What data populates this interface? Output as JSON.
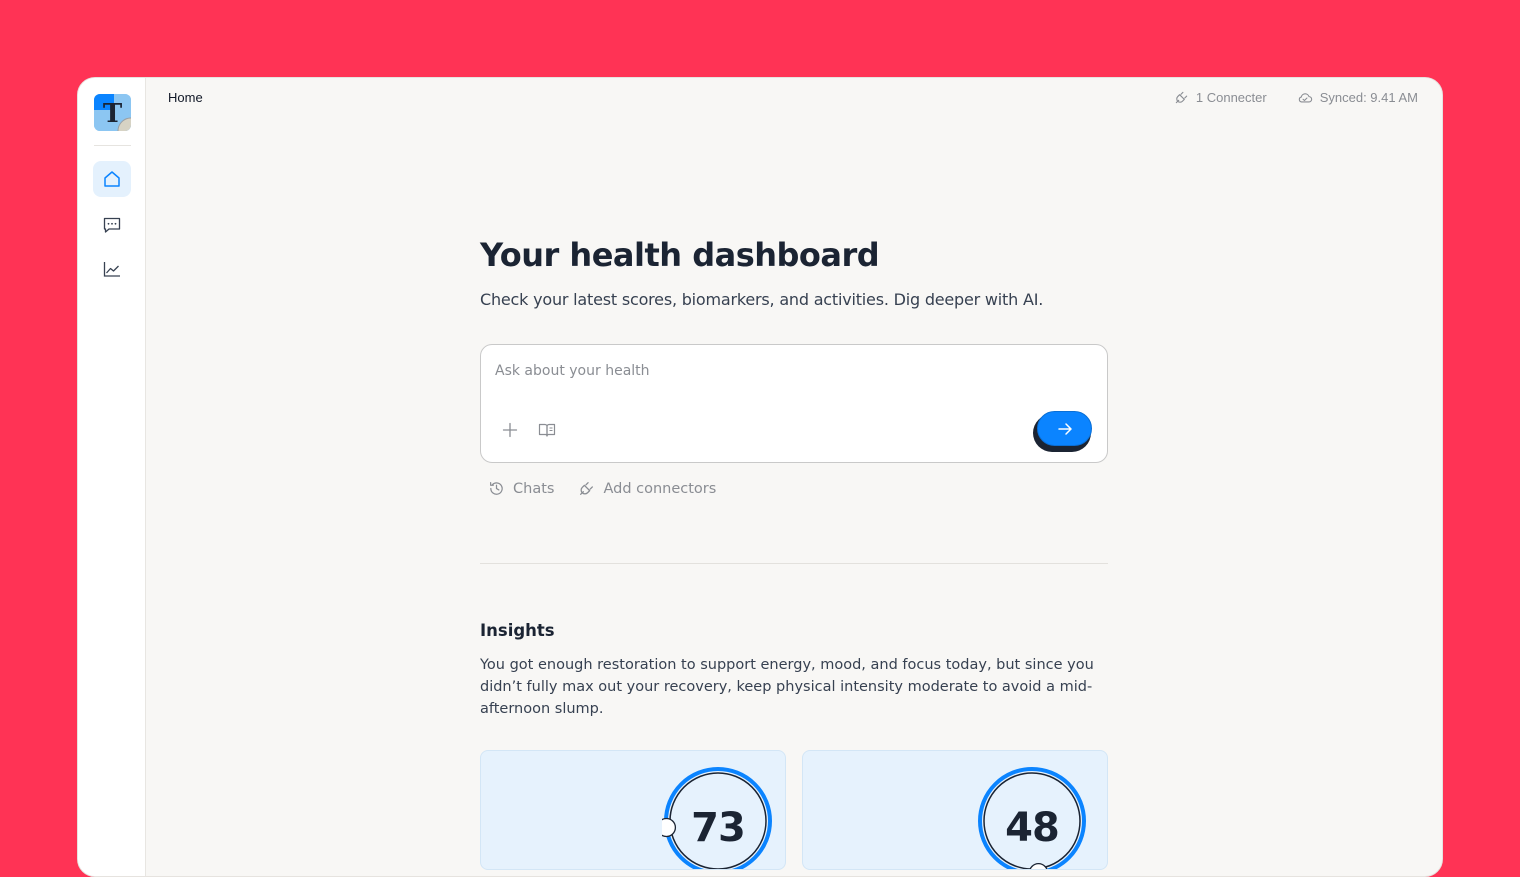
{
  "breadcrumb": "Home",
  "topbar": {
    "connectors": "1 Connecter",
    "synced": "Synced: 9.41 AM"
  },
  "sidebar": {
    "items": [
      {
        "icon": "home-icon",
        "active": true
      },
      {
        "icon": "chat-icon",
        "active": false
      },
      {
        "icon": "chart-icon",
        "active": false
      }
    ]
  },
  "main": {
    "title": "Your health dashboard",
    "subtitle": "Check your latest scores, biomarkers, and activities. Dig deeper with AI.",
    "ask": {
      "placeholder": "Ask about your health",
      "value": ""
    },
    "links": {
      "chats": "Chats",
      "add_connectors": "Add connectors"
    },
    "insights": {
      "title": "Insights",
      "text": "You got enough restoration to support energy, mood, and focus today, but since you didn’t fully max out your recovery, keep physical intensity moderate to avoid a mid-afternoon slump."
    },
    "scores": [
      {
        "value": "73",
        "level": 0.73
      },
      {
        "value": "48",
        "level": 0.48
      }
    ]
  },
  "colors": {
    "background": "#FF3355",
    "accent": "#0B84FF",
    "card": "#E6F2FD"
  }
}
